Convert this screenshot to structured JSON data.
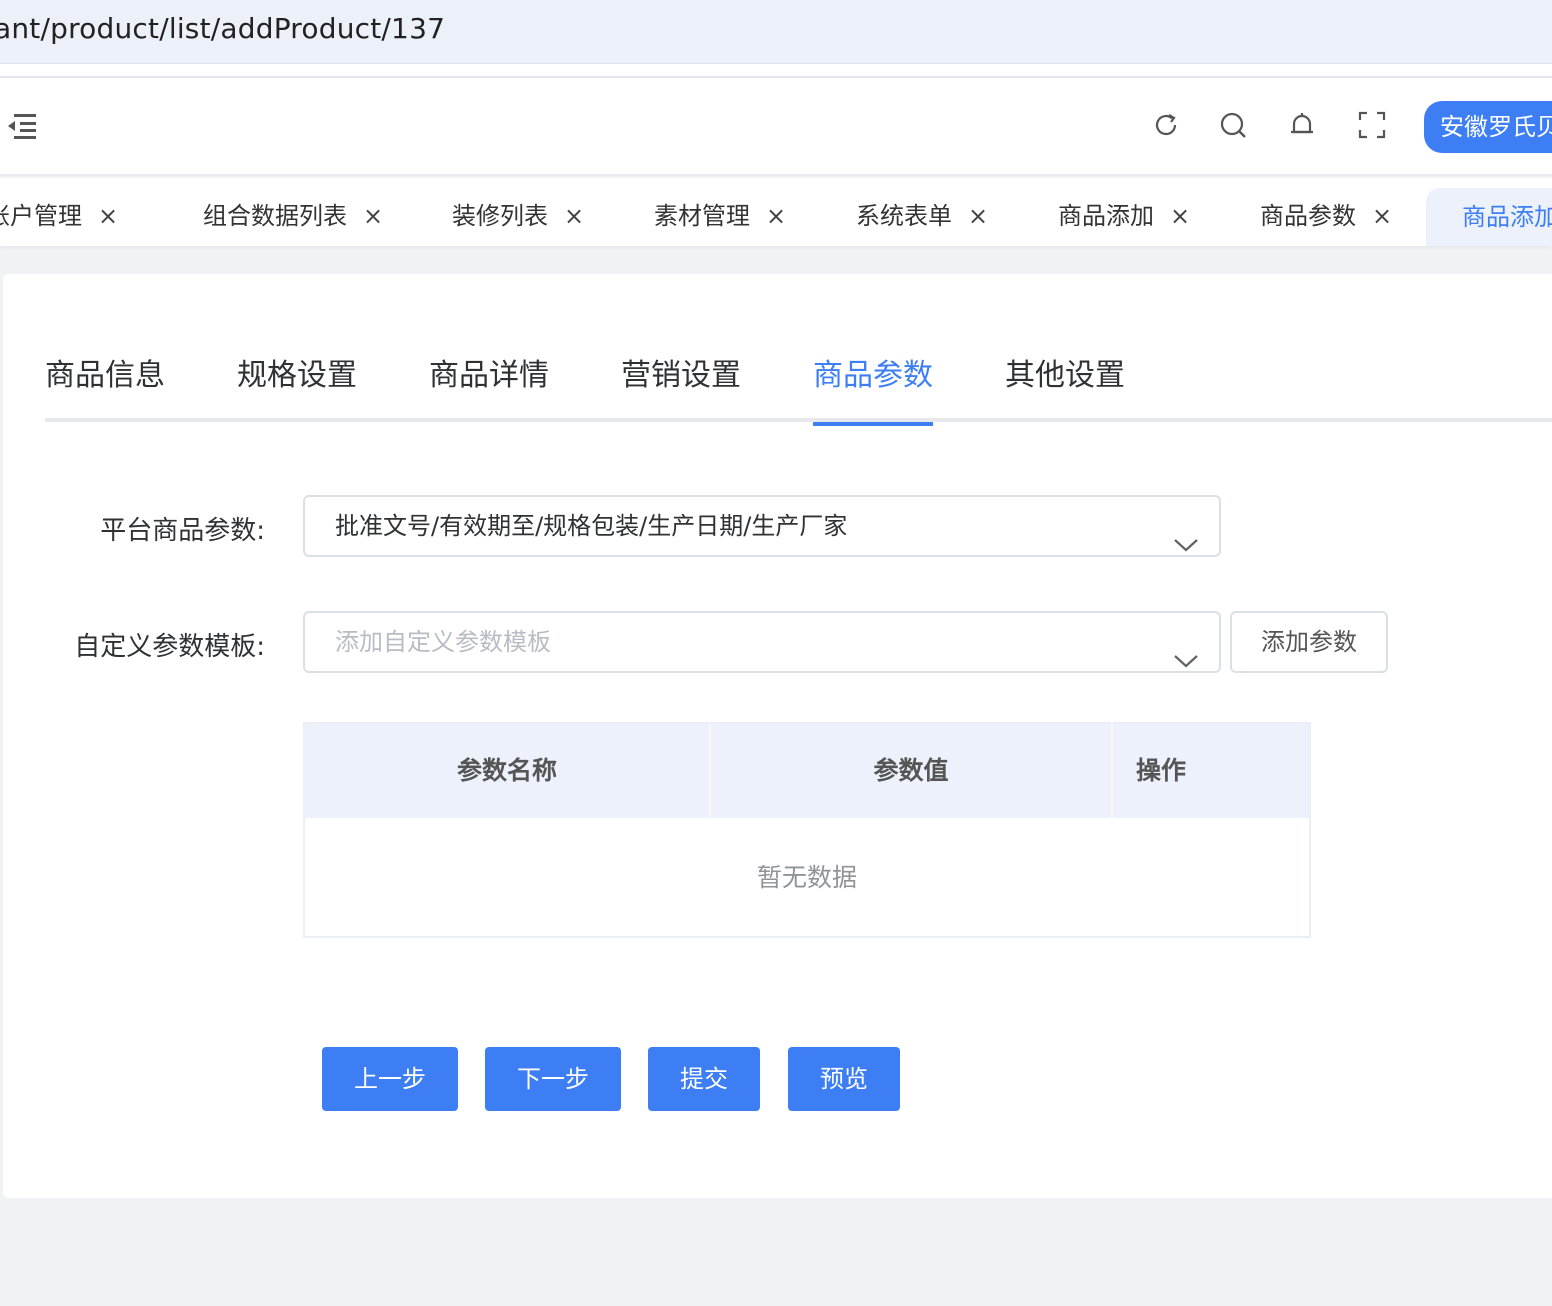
{
  "browser": {
    "url": "ant/product/list/addProduct/137"
  },
  "header": {
    "icons": [
      "menu-fold-icon",
      "refresh-icon",
      "search-icon",
      "bell-icon",
      "fullscreen-icon"
    ],
    "user_name": "安徽罗氏贝"
  },
  "tags_view": {
    "tags": [
      {
        "label": "账户管理"
      },
      {
        "label": "组合数据列表"
      },
      {
        "label": "装修列表"
      },
      {
        "label": "素材管理"
      },
      {
        "label": "系统表单"
      },
      {
        "label": "商品添加"
      },
      {
        "label": "商品参数"
      },
      {
        "label": "商品添加"
      }
    ],
    "close_glyph": "×"
  },
  "step_tabs": [
    {
      "label": "商品信息"
    },
    {
      "label": "规格设置"
    },
    {
      "label": "商品详情"
    },
    {
      "label": "营销设置"
    },
    {
      "label": "商品参数"
    },
    {
      "label": "其他设置"
    }
  ],
  "form": {
    "platform_params_label": "平台商品参数:",
    "platform_params_value": "批准文号/有效期至/规格包装/生产日期/生产厂家",
    "custom_template_label": "自定义参数模板:",
    "custom_template_placeholder": "添加自定义参数模板",
    "add_param_button": "添加参数"
  },
  "table": {
    "columns": [
      "参数名称",
      "参数值",
      "操作"
    ],
    "rows": [],
    "empty_text": "暂无数据"
  },
  "buttons": {
    "prev": "上一步",
    "next": "下一步",
    "submit": "提交",
    "preview": "预览"
  },
  "colors": {
    "accent": "#3d7ef5",
    "header_bg": "#ecf1fb",
    "page_bg": "#f0f2f5"
  }
}
